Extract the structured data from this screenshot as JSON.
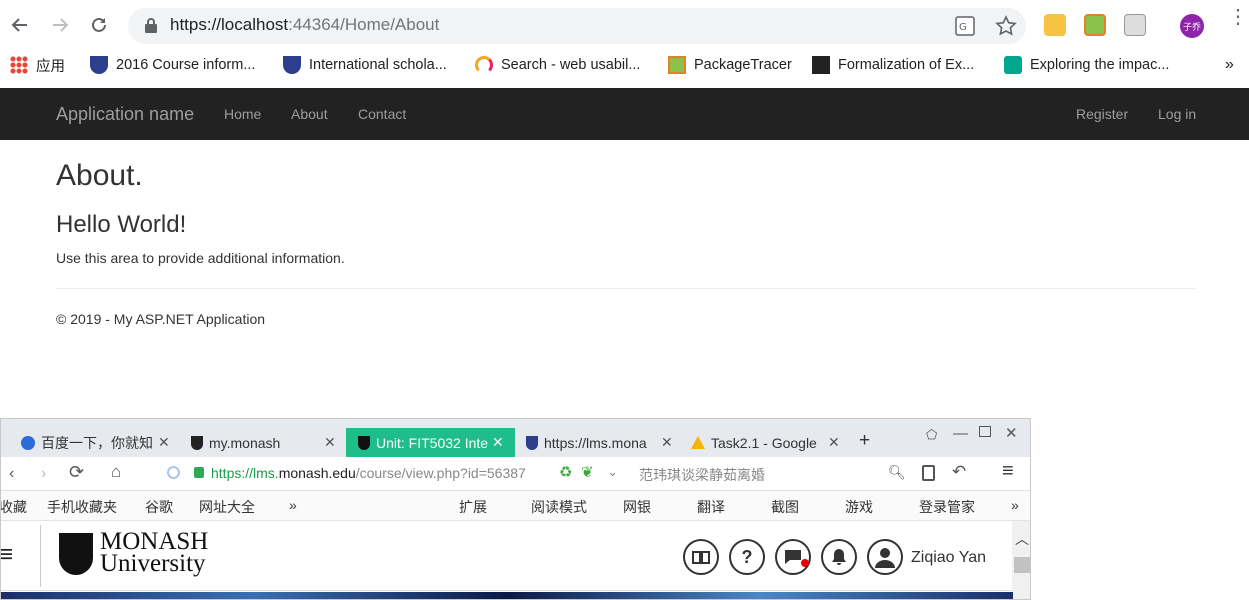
{
  "browser": {
    "url_host": "https://localhost",
    "url_rest": ":44364/Home/About",
    "apps_label": "应用",
    "bookmarks": [
      {
        "label": "2016 Course inform...",
        "icon": "university-shield-icon"
      },
      {
        "label": "International schola...",
        "icon": "university-shield-icon"
      },
      {
        "label": "Search - web usabil...",
        "icon": "rainbow-arc-icon"
      },
      {
        "label": "PackageTracer",
        "icon": "package-icon"
      },
      {
        "label": "Formalization of Ex...",
        "icon": "igi-logo-icon"
      },
      {
        "label": "Exploring the impac...",
        "icon": "elsevier-icon"
      }
    ],
    "more_bookmarks": "»",
    "profile_avatar_text": "子乔"
  },
  "app": {
    "brand": "Application name",
    "nav": [
      "Home",
      "About",
      "Contact"
    ],
    "nav_right": [
      "Register",
      "Log in"
    ],
    "title": "About.",
    "subtitle": "Hello World!",
    "body_text": "Use this area to provide additional information.",
    "footer": "© 2019 - My ASP.NET Application",
    "navbar_color": "#222222"
  },
  "second_window": {
    "tabs": [
      {
        "label": "百度一下，你就知",
        "close": "✕"
      },
      {
        "label": "my.monash",
        "close": "✕"
      },
      {
        "label": "Unit: FIT5032 Inte",
        "close": "✕",
        "active": true
      },
      {
        "label": "https://lms.mona",
        "close": "✕"
      },
      {
        "label": "Task2.1 - Google",
        "close": "✕"
      }
    ],
    "new_tab": "+",
    "url_secure": "https://lms.",
    "url_domain": "monash.edu",
    "url_rest": "/course/view.php?id=56387",
    "search_hint": "范玮琪谈梁静茹离婚",
    "bookmarks_left": [
      "收藏",
      "手机收藏夹",
      "谷歌",
      "网址大全",
      "»"
    ],
    "bookmarks_right": [
      "扩展",
      "阅读模式",
      "网银",
      "翻译",
      "截图",
      "游戏",
      "登录管家",
      "»"
    ],
    "logo_line1": "MONASH",
    "logo_line2": "University",
    "user_name": "Ziqiao Yan",
    "active_tab_color": "#1fbd8a"
  }
}
